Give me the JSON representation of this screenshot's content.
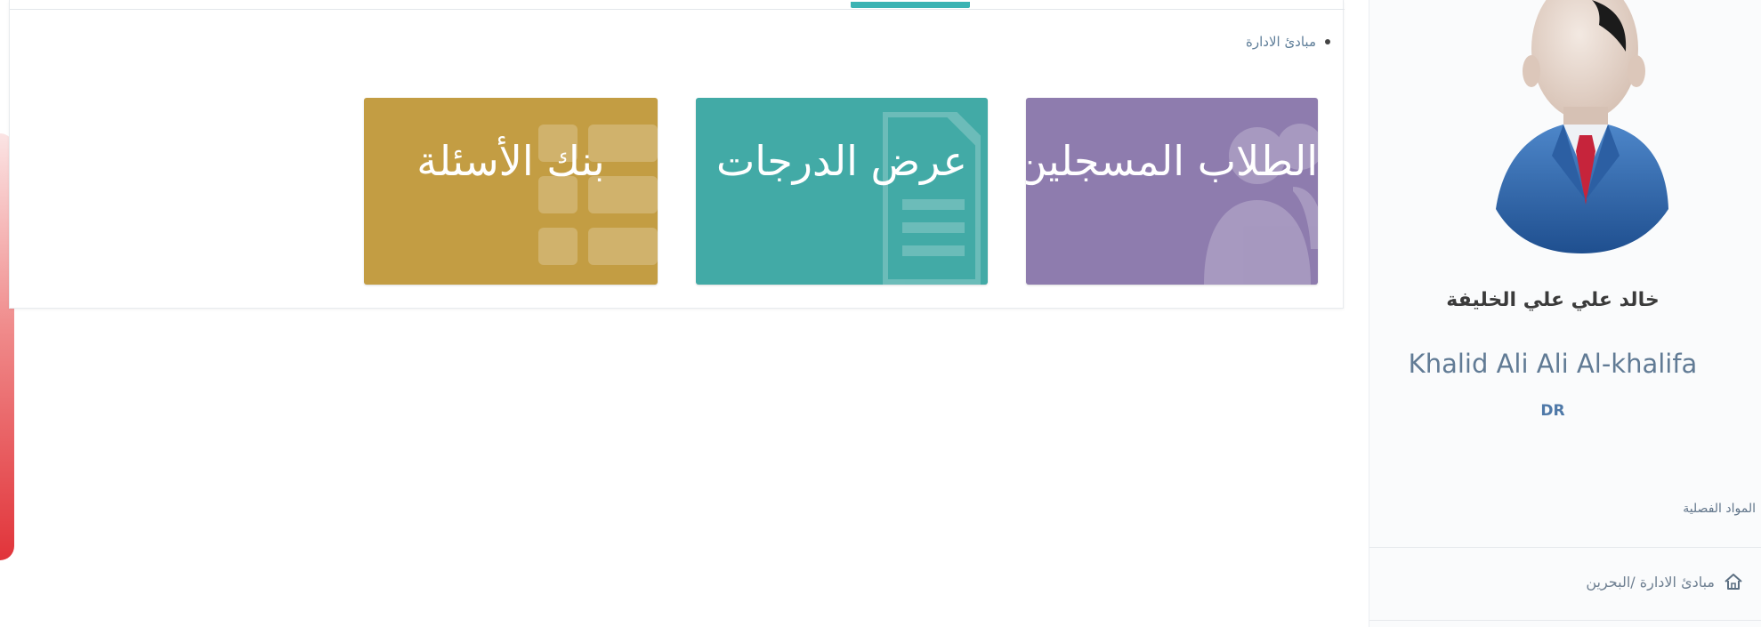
{
  "breadcrumb": {
    "current": "مبادئ الادارة"
  },
  "tiles": {
    "students": {
      "label": "الطلاب المسجلين",
      "color": "#8e7cae",
      "icon": "users-icon"
    },
    "grades": {
      "label": "عرض الدرجات",
      "color": "#42aaa6",
      "icon": "document-icon"
    },
    "question_bank": {
      "label": "بنك الأسئلة",
      "color": "#c39d43",
      "icon": "grid-icon"
    }
  },
  "profile": {
    "name_ar": "خالد علي علي الخليفة",
    "name_en": "Khalid Ali Ali Al-khalifa",
    "title": "DR"
  },
  "sidebar": {
    "semester_subjects": "المواد الفصلية",
    "course_link": "مبادئ الادارة /البحرين",
    "course_icon": "home-icon"
  },
  "colors": {
    "accent": "#3cb3b3",
    "link": "#5f7e99"
  }
}
